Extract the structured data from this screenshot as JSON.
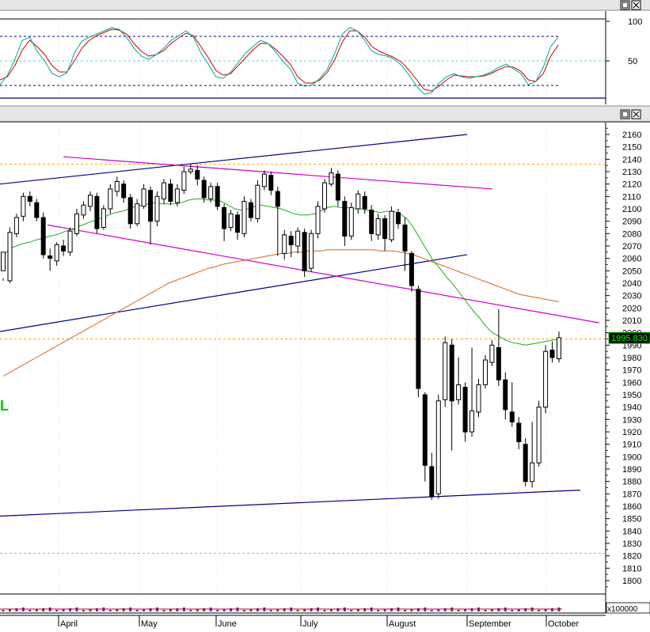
{
  "chart_data": {
    "type": "candlestick",
    "title": "",
    "x_axis": {
      "months": [
        "April",
        "May",
        "June",
        "July",
        "August",
        "September",
        "October"
      ]
    },
    "stochastic_panel": {
      "tick_labels": [
        "100",
        "50"
      ],
      "ylim": [
        0,
        100
      ],
      "levels": {
        "upper": 80,
        "middle": 50,
        "lower": 20
      },
      "k_line_color": "#00aa88",
      "d_line_color": "#cc0000",
      "k_values": [
        20,
        32,
        52,
        76,
        80,
        62,
        50,
        34,
        30,
        35,
        60,
        75,
        80,
        84,
        88,
        92,
        90,
        80,
        66,
        56,
        52,
        58,
        66,
        76,
        82,
        88,
        80,
        60,
        46,
        30,
        28,
        36,
        48,
        60,
        68,
        76,
        72,
        62,
        50,
        40,
        22,
        18,
        20,
        28,
        40,
        60,
        84,
        92,
        88,
        76,
        62,
        58,
        56,
        52,
        44,
        32,
        18,
        8,
        10,
        22,
        30,
        34,
        30,
        28,
        30,
        32,
        36,
        42,
        46,
        40,
        34,
        20,
        24,
        42,
        68,
        80
      ],
      "d_values": [
        26,
        30,
        44,
        64,
        76,
        68,
        58,
        44,
        36,
        36,
        50,
        66,
        76,
        82,
        86,
        90,
        89,
        84,
        72,
        62,
        56,
        58,
        63,
        72,
        79,
        85,
        82,
        68,
        54,
        38,
        32,
        34,
        44,
        54,
        64,
        72,
        72,
        65,
        56,
        46,
        30,
        22,
        22,
        26,
        36,
        52,
        74,
        88,
        88,
        80,
        68,
        62,
        58,
        54,
        48,
        38,
        26,
        14,
        12,
        18,
        26,
        32,
        31,
        30,
        30,
        31,
        34,
        39,
        43,
        42,
        37,
        26,
        24,
        34,
        56,
        70
      ]
    },
    "price_panel": {
      "tick_labels": [
        "2160",
        "2150",
        "2140",
        "2130",
        "2120",
        "2110",
        "2100",
        "2090",
        "2080",
        "2070",
        "2060",
        "2050",
        "2040",
        "2030",
        "2020",
        "2010",
        "2000",
        "1990",
        "1980",
        "1970",
        "1960",
        "1950",
        "1940",
        "1930",
        "1920",
        "1910",
        "1900",
        "1890",
        "1880",
        "1870",
        "1860",
        "1850",
        "1840",
        "1830",
        "1820",
        "1810",
        "1800"
      ],
      "ylim": [
        1790,
        2170
      ],
      "last_price_label": "1995.830",
      "last_price": 1995.83,
      "horizontal_levels": [
        2136,
        1995,
        1822
      ],
      "side_label": "L",
      "candles": [
        [
          2050,
          2065,
          2044,
          2042
        ],
        [
          2042,
          2081,
          2040,
          2085
        ],
        [
          2080,
          2093,
          2077,
          2096
        ],
        [
          2094,
          2110,
          2090,
          2113
        ],
        [
          2110,
          2106,
          2102,
          2114
        ],
        [
          2105,
          2093,
          2090,
          2108
        ],
        [
          2093,
          2063,
          2060,
          2097
        ],
        [
          2062,
          2060,
          2050,
          2068
        ],
        [
          2058,
          2071,
          2054,
          2073
        ],
        [
          2070,
          2066,
          2062,
          2075
        ],
        [
          2065,
          2082,
          2062,
          2085
        ],
        [
          2080,
          2096,
          2078,
          2100
        ],
        [
          2095,
          2103,
          2092,
          2106
        ],
        [
          2102,
          2111,
          2098,
          2114
        ],
        [
          2110,
          2084,
          2080,
          2113
        ],
        [
          2085,
          2100,
          2083,
          2103
        ],
        [
          2100,
          2116,
          2096,
          2120
        ],
        [
          2114,
          2122,
          2110,
          2126
        ],
        [
          2120,
          2109,
          2105,
          2123
        ],
        [
          2109,
          2088,
          2084,
          2112
        ],
        [
          2088,
          2104,
          2086,
          2108
        ],
        [
          2102,
          2116,
          2100,
          2120
        ],
        [
          2115,
          2090,
          2071,
          2118
        ],
        [
          2090,
          2110,
          2086,
          2114
        ],
        [
          2108,
          2121,
          2104,
          2124
        ],
        [
          2120,
          2106,
          2103,
          2124
        ],
        [
          2105,
          2116,
          2102,
          2120
        ],
        [
          2115,
          2130,
          2112,
          2134
        ],
        [
          2130,
          2132,
          2128,
          2136
        ],
        [
          2131,
          2124,
          2119,
          2135
        ],
        [
          2123,
          2109,
          2105,
          2126
        ],
        [
          2108,
          2118,
          2105,
          2121
        ],
        [
          2118,
          2102,
          2099,
          2121
        ],
        [
          2101,
          2084,
          2074,
          2104
        ],
        [
          2085,
          2096,
          2082,
          2099
        ],
        [
          2095,
          2081,
          2075,
          2098
        ],
        [
          2080,
          2106,
          2077,
          2110
        ],
        [
          2105,
          2093,
          2090,
          2108
        ],
        [
          2092,
          2119,
          2089,
          2123
        ],
        [
          2118,
          2128,
          2115,
          2131
        ],
        [
          2127,
          2115,
          2111,
          2130
        ],
        [
          2114,
          2102,
          2062,
          2118
        ],
        [
          2064,
          2079,
          2059,
          2083
        ],
        [
          2078,
          2071,
          2061,
          2082
        ],
        [
          2070,
          2082,
          2064,
          2085
        ],
        [
          2081,
          2050,
          2045,
          2084
        ],
        [
          2052,
          2080,
          2049,
          2083
        ],
        [
          2080,
          2102,
          2076,
          2106
        ],
        [
          2100,
          2121,
          2097,
          2124
        ],
        [
          2120,
          2129,
          2118,
          2133
        ],
        [
          2128,
          2107,
          2102,
          2131
        ],
        [
          2106,
          2078,
          2070,
          2110
        ],
        [
          2078,
          2101,
          2075,
          2105
        ],
        [
          2100,
          2112,
          2096,
          2115
        ],
        [
          2110,
          2100,
          2096,
          2114
        ],
        [
          2099,
          2080,
          2074,
          2103
        ],
        [
          2079,
          2092,
          2075,
          2096
        ],
        [
          2092,
          2076,
          2066,
          2095
        ],
        [
          2075,
          2098,
          2073,
          2102
        ],
        [
          2097,
          2088,
          2084,
          2100
        ],
        [
          2087,
          2066,
          2050,
          2093
        ],
        [
          2064,
          2038,
          2033,
          2066
        ],
        [
          2035,
          1955,
          1948,
          2038
        ],
        [
          1950,
          1893,
          1880,
          1952
        ],
        [
          1892,
          1868,
          1865,
          1903
        ],
        [
          1870,
          1945,
          1866,
          1950
        ],
        [
          1946,
          1992,
          1940,
          1997
        ],
        [
          1990,
          1945,
          1905,
          1995
        ],
        [
          1946,
          1958,
          1942,
          1980
        ],
        [
          1956,
          1920,
          1912,
          1960
        ],
        [
          1920,
          1937,
          1916,
          1988
        ],
        [
          1936,
          1958,
          1932,
          1963
        ],
        [
          1958,
          1978,
          1955,
          1982
        ],
        [
          1976,
          1990,
          1973,
          1994
        ],
        [
          1988,
          1962,
          1957,
          2019
        ],
        [
          1962,
          1938,
          1930,
          1968
        ],
        [
          1936,
          1928,
          1924,
          1960
        ],
        [
          1927,
          1912,
          1906,
          1932
        ],
        [
          1910,
          1880,
          1876,
          1915
        ],
        [
          1880,
          1895,
          1875,
          1928
        ],
        [
          1895,
          1940,
          1892,
          1945
        ],
        [
          1940,
          1985,
          1935,
          1990
        ],
        [
          1986,
          1980,
          1976,
          1993
        ],
        [
          1979,
          1996,
          1976,
          2001
        ]
      ],
      "sma_green": [
        2062,
        2068,
        2070,
        2072,
        2073,
        2075,
        2076,
        2078,
        2079,
        2081,
        2083,
        2085,
        2087,
        2089,
        2091,
        2093,
        2095,
        2097,
        2098,
        2100,
        2102,
        2103,
        2104,
        2105,
        2104,
        2104,
        2104,
        2105,
        2107,
        2108,
        2108,
        2107,
        2107,
        2106,
        2103,
        2100,
        2099,
        2100,
        2102,
        2103,
        2102,
        2101,
        2100,
        2098,
        2096,
        2095,
        2095,
        2096,
        2098,
        2101,
        2102,
        2101,
        2101,
        2100,
        2100,
        2099,
        2098,
        2097,
        2098,
        2098,
        2096,
        2092,
        2085,
        2076,
        2067,
        2058,
        2052,
        2045,
        2039,
        2032,
        2025,
        2018,
        2012,
        2005,
        2000,
        1997,
        1994,
        1992,
        1991,
        1990,
        1991,
        1992,
        1993,
        1994,
        1995
      ],
      "sma_orange": [
        1965,
        1968,
        1971,
        1974,
        1977,
        1980,
        1983,
        1986,
        1989,
        1992,
        1995,
        1998,
        2001,
        2004,
        2007,
        2010,
        2013,
        2016,
        2019,
        2022,
        2025,
        2028,
        2031,
        2034,
        2037,
        2040,
        2042,
        2044,
        2046,
        2048,
        2050,
        2052,
        2053,
        2055,
        2056,
        2057,
        2058,
        2059,
        2060,
        2061,
        2062,
        2063,
        2064,
        2064,
        2065,
        2065,
        2066,
        2066,
        2066,
        2067,
        2067,
        2067,
        2067,
        2067,
        2067,
        2067,
        2067,
        2066,
        2066,
        2066,
        2065,
        2064,
        2063,
        2061,
        2059,
        2057,
        2055,
        2053,
        2051,
        2049,
        2047,
        2045,
        2043,
        2041,
        2039,
        2037,
        2035,
        2033,
        2031,
        2030,
        2029,
        2028,
        2027,
        2026,
        2025
      ]
    },
    "trendlines": [
      {
        "color": "#000080",
        "from": [
          0,
          2120
        ],
        "to": [
          590,
          2160
        ]
      },
      {
        "color": "#000080",
        "from": [
          0,
          2001
        ],
        "to": [
          590,
          2063
        ]
      },
      {
        "color": "#000080",
        "from": [
          0,
          1852
        ],
        "to": [
          733,
          1873
        ]
      },
      {
        "color": "#cc00cc",
        "from": [
          80,
          2142
        ],
        "to": [
          622,
          2116
        ]
      },
      {
        "color": "#cc00cc",
        "from": [
          60,
          2087
        ],
        "to": [
          757,
          2008
        ]
      }
    ],
    "volume_panel": {
      "unit_label": "x100000"
    }
  }
}
